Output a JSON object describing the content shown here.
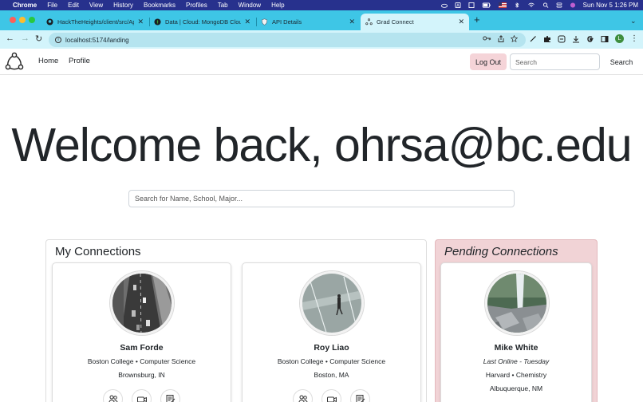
{
  "menubar": {
    "items": [
      "Chrome",
      "File",
      "Edit",
      "View",
      "History",
      "Bookmarks",
      "Profiles",
      "Tab",
      "Window",
      "Help"
    ],
    "clock": "Sun Nov 5  1:26 PM"
  },
  "tabs": [
    {
      "label": "HackTheHeights/client/src/Ap",
      "icon": "github-icon"
    },
    {
      "label": "Data | Cloud: MongoDB Cloud",
      "icon": "mongodb-icon"
    },
    {
      "label": "API Details",
      "icon": "shield-icon"
    },
    {
      "label": "Grad Connect",
      "icon": "gradconnect-icon",
      "active": true
    }
  ],
  "address": {
    "url": "localhost:5174/landing"
  },
  "profile_initial": "L",
  "nav": {
    "home": "Home",
    "profile": "Profile",
    "logout": "Log Out",
    "search_placeholder": "Search",
    "search_button": "Search"
  },
  "main": {
    "welcome": "Welcome back, ohrsa@bc.edu",
    "search_placeholder": "Search for Name, School, Major..."
  },
  "connections": {
    "title": "My Connections",
    "cards": [
      {
        "name": "Sam Forde",
        "line1": "Boston College • Computer Science",
        "line2": "Brownsburg, IN"
      },
      {
        "name": "Roy Liao",
        "line1": "Boston College • Computer Science",
        "line2": "Boston, MA"
      }
    ]
  },
  "pending": {
    "title": "Pending Connections",
    "cards": [
      {
        "name": "Mike White",
        "status": "Last Online - Tuesday",
        "line1": "Harvard • Chemistry",
        "line2": "Albuquerque, NM"
      }
    ]
  },
  "colors": {
    "menubar": "#27318d",
    "tabstrip": "#3ec6e6",
    "toolbar": "#d3f4fb",
    "logout_bg": "#f5d4d8",
    "pending_bg": "#f1d3d6"
  }
}
